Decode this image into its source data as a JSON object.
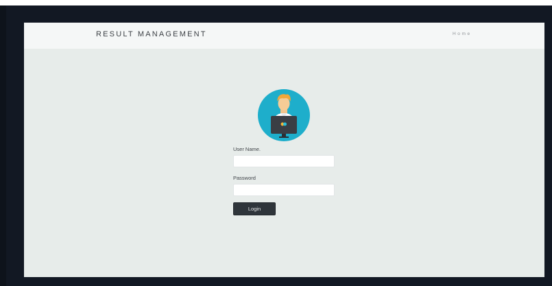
{
  "navbar": {
    "brand": "RESULT MANAGEMENT",
    "home_link": "Home"
  },
  "login_form": {
    "avatar_icon": "user-at-computer-icon",
    "username_label": "User Name.",
    "username_value": "",
    "password_label": "Password",
    "password_value": "",
    "login_button": "Login"
  },
  "colors": {
    "page_background": "#e7ecea",
    "navbar_background": "#f5f7f7",
    "avatar_circle": "#1eaecb",
    "button_background": "#2f353b"
  }
}
